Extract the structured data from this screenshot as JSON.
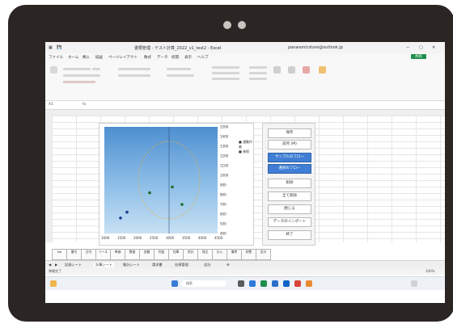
{
  "window": {
    "title": "書類管理 - テスト計算_2022_v1_test2 - Excel",
    "user": "panasonicstore@outlook.jp"
  },
  "ribbon_tabs": [
    "ファイル",
    "ホーム",
    "挿入",
    "描画",
    "ページレイアウト",
    "数式",
    "データ",
    "校閲",
    "表示",
    "ヘルプ"
  ],
  "formula_bar": {
    "name_box": "A1",
    "content": ""
  },
  "chart": {
    "legend": [
      "連動作者",
      "参照"
    ]
  },
  "chart_data": {
    "type": "scatter",
    "x_ticks": [
      "1000",
      "1500",
      "2000",
      "2500",
      "3000",
      "3500",
      "4000",
      "4500"
    ],
    "y_ticks": [
      "1500",
      "1400",
      "1300",
      "1200",
      "1100",
      "1000",
      "900",
      "800",
      "700",
      "600",
      "500",
      "400"
    ],
    "series": [
      {
        "name": "連動作者",
        "x": [
          2400,
          3100,
          3400
        ],
        "y": [
          820,
          880,
          700
        ]
      },
      {
        "name": "参照",
        "x": [
          1700,
          1500
        ],
        "y": [
          620,
          560
        ]
      }
    ]
  },
  "panel_buttons": [
    "保存",
    "前月 (M)",
    "サンプルのフロー",
    "選択のフロー",
    "削除",
    "全て削除",
    "閉じる",
    "データのインポート",
    "終了"
  ],
  "bottom_buttons": [
    "No",
    "番号",
    "日付",
    "ソース",
    "単価",
    "数量",
    "金額",
    "利益",
    "在庫",
    "合計",
    "発注",
    "仕入",
    "備考",
    "状態",
    "区分"
  ],
  "sheet_tabs": [
    "記録シート",
    "計算シート",
    "集計シート",
    "請求書",
    "在庫管理",
    "会計"
  ],
  "status": {
    "left": "準備完了",
    "zoom": "100%"
  },
  "taskbar": {
    "search": "検索"
  }
}
